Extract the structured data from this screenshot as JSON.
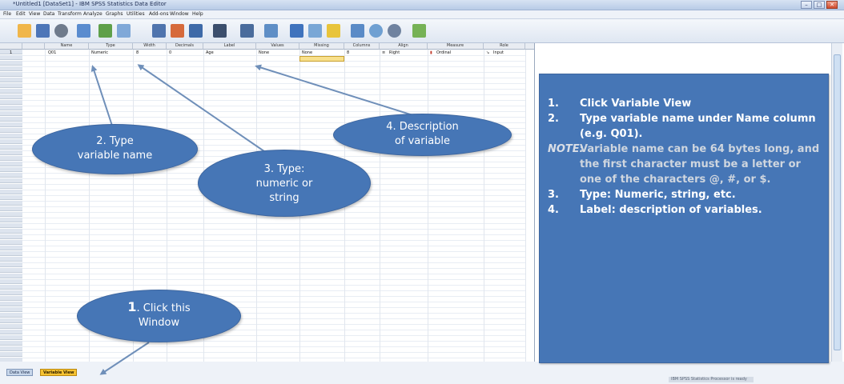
{
  "window": {
    "title": "*Untitled1 [DataSet1] - IBM SPSS Statistics Data Editor",
    "controls": [
      "–",
      "□",
      "✕"
    ]
  },
  "menu": [
    "File",
    "Edit",
    "View",
    "Data",
    "Transform",
    "Analyze",
    "Graphs",
    "Utilities",
    "Add-ons",
    "Window",
    "Help"
  ],
  "toolbar_icons": [
    "open-icon",
    "save-icon",
    "print-icon",
    "dialog-recall-icon",
    "undo-icon",
    "redo-icon",
    "goto-case-icon",
    "goto-variable-icon",
    "variables-icon",
    "find-icon",
    "insert-cases-icon",
    "insert-variable-icon",
    "split-file-icon",
    "weight-cases-icon",
    "select-cases-icon",
    "value-labels-icon",
    "use-sets-icon",
    "show-all-variables-icon",
    "spell-check-icon"
  ],
  "grid": {
    "columns": [
      "Name",
      "Type",
      "Width",
      "Decimals",
      "Label",
      "Values",
      "Missing",
      "Columns",
      "Align",
      "Measure",
      "Role"
    ],
    "row1": {
      "num": "1",
      "name": "Q01",
      "type": "Numeric",
      "width": "8",
      "decimals": "0",
      "label": "Age",
      "values": "None",
      "missing": "None",
      "columns": "8",
      "align": "Right",
      "measure": "Ordinal",
      "role": "Input"
    }
  },
  "tabs": {
    "data_view": "Data View",
    "variable_view": "Variable View"
  },
  "status_text": "IBM SPSS Statistics Processor is ready",
  "callouts": {
    "c1_num": "1",
    "c1_text": ". Click this",
    "c1_text2": "Window",
    "c2_line1": "2. Type",
    "c2_line2": "variable name",
    "c3_line1": "3. Type:",
    "c3_line2": "numeric or",
    "c3_line3": "string",
    "c4_line1": "4. Description",
    "c4_line2": "of variable"
  },
  "info": {
    "step1_num": "1.",
    "step1": "Click Variable View",
    "step2_num": "2.",
    "step2": "Type variable name under Name column (e.g. Q01).",
    "note_label": "NOTE:",
    "note_text": "Variable name can be 64 bytes long, and the first character must be a letter or one of the characters @, #, or $.",
    "step3_num": "3.",
    "step3": "Type: Numeric, string, etc.",
    "step4_num": "4.",
    "step4": "Label: description of variables."
  },
  "colors": {
    "callout": "#4676b6",
    "arrow": "#6f8fb9",
    "variable_view_tab": "#f6c231",
    "selected_cell": "#f8e08c"
  }
}
